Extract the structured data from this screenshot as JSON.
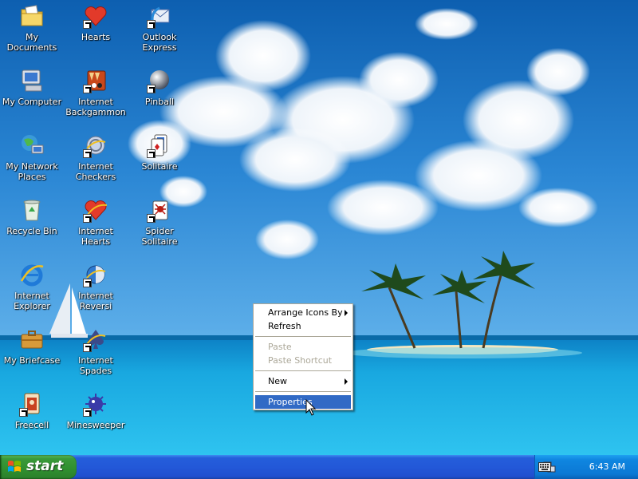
{
  "desktop": {
    "icons": [
      {
        "label": "My Documents",
        "icon": "my-documents-icon"
      },
      {
        "label": "Hearts",
        "icon": "hearts-icon"
      },
      {
        "label": "Outlook Express",
        "icon": "outlook-express-icon"
      },
      {
        "label": "My Computer",
        "icon": "my-computer-icon"
      },
      {
        "label": "Internet Backgammon",
        "icon": "internet-backgammon-icon"
      },
      {
        "label": "Pinball",
        "icon": "pinball-icon"
      },
      {
        "label": "My Network Places",
        "icon": "my-network-places-icon"
      },
      {
        "label": "Internet Checkers",
        "icon": "internet-checkers-icon"
      },
      {
        "label": "Solitaire",
        "icon": "solitaire-icon"
      },
      {
        "label": "Recycle Bin",
        "icon": "recycle-bin-icon"
      },
      {
        "label": "Internet Hearts",
        "icon": "internet-hearts-icon"
      },
      {
        "label": "Spider Solitaire",
        "icon": "spider-solitaire-icon"
      },
      {
        "label": "Internet Explorer",
        "icon": "internet-explorer-icon"
      },
      {
        "label": "Internet Reversi",
        "icon": "internet-reversi-icon"
      },
      {
        "label": "My Briefcase",
        "icon": "my-briefcase-icon"
      },
      {
        "label": "Internet Spades",
        "icon": "internet-spades-icon"
      },
      {
        "label": "Freecell",
        "icon": "freecell-icon"
      },
      {
        "label": "Minesweeper",
        "icon": "minesweeper-icon"
      }
    ]
  },
  "context_menu": {
    "arrange_icons_by": "Arrange Icons By",
    "refresh": "Refresh",
    "paste": "Paste",
    "paste_shortcut": "Paste Shortcut",
    "new": "New",
    "properties": "Properties"
  },
  "taskbar": {
    "start_label": "start",
    "clock": "6:43 AM"
  },
  "colors": {
    "taskbar_blue": "#245edb",
    "start_green": "#3a9a3a",
    "menu_highlight": "#316ac5"
  }
}
